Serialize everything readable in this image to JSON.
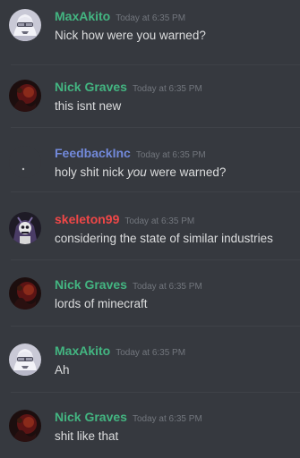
{
  "colors": {
    "background": "#36393f",
    "divider": "#3f4248",
    "text": "#dcddde",
    "timestamp": "#72767d"
  },
  "messages": [
    {
      "username": "MaxAkito",
      "username_color": "#43b581",
      "timestamp": "Today at 6:35 PM",
      "text": "Nick how were you warned?",
      "avatar": "maxakito-avatar-icon"
    },
    {
      "username": "Nick Graves",
      "username_color": "#43b581",
      "timestamp": "Today at 6:35 PM",
      "text": "this isnt new",
      "avatar": "nick-graves-avatar-icon"
    },
    {
      "username": "FeedbackInc",
      "username_color": "#7289da",
      "timestamp": "Today at 6:35 PM",
      "text_before": "holy shit nick ",
      "text_emphasis": "you",
      "text_after": " were warned?",
      "avatar": "feedbackinc-avatar-icon"
    },
    {
      "username": "skeleton99",
      "username_color": "#f04747",
      "timestamp": "Today at 6:35 PM",
      "text": "considering the state of similar industries",
      "avatar": "skeleton99-avatar-icon"
    },
    {
      "username": "Nick Graves",
      "username_color": "#43b581",
      "timestamp": "Today at 6:35 PM",
      "text": "lords of minecraft",
      "avatar": "nick-graves-avatar-icon"
    },
    {
      "username": "MaxAkito",
      "username_color": "#43b581",
      "timestamp": "Today at 6:35 PM",
      "text": "Ah",
      "avatar": "maxakito-avatar-icon"
    },
    {
      "username": "Nick Graves",
      "username_color": "#43b581",
      "timestamp": "Today at 6:35 PM",
      "text": "shit like that",
      "avatar": "nick-graves-avatar-icon"
    }
  ]
}
